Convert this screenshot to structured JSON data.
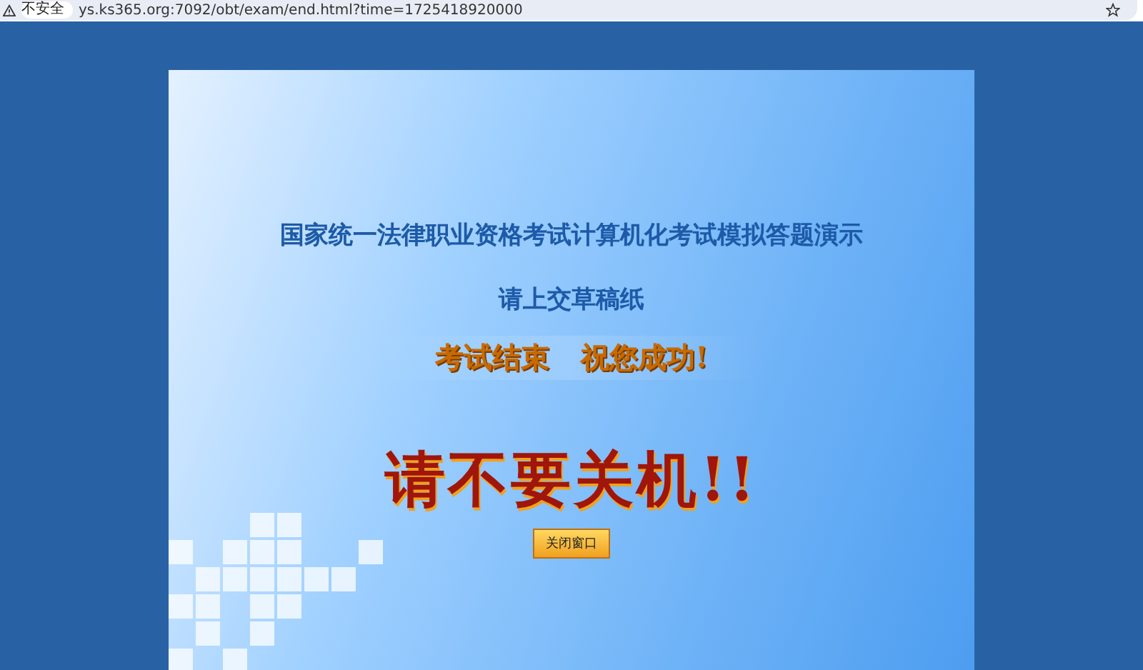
{
  "address_bar": {
    "security_label": "不安全",
    "url": "ys.ks365.org:7092/obt/exam/end.html?time=1725418920000"
  },
  "panel": {
    "title": "国家统一法律职业资格考试计算机化考试模拟答题演示",
    "subtitle": "请上交草稿纸",
    "banner": [
      "考试结束",
      "祝您成功!"
    ],
    "warning": "请不要关机!!",
    "close_button": "关闭窗口"
  }
}
